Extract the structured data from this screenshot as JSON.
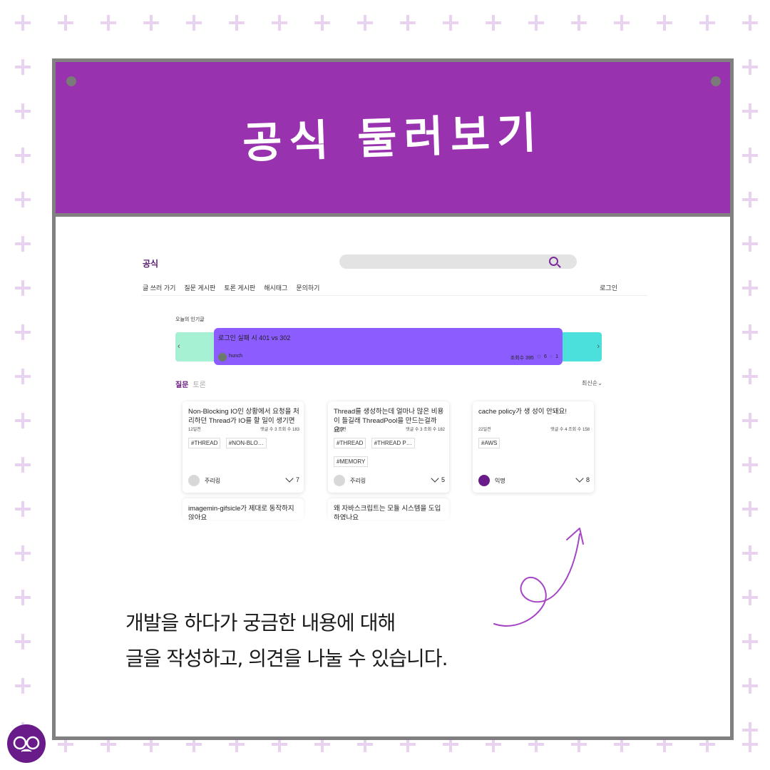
{
  "header": {
    "title": "공식 둘러보기"
  },
  "site": {
    "brand": "공식",
    "nav": [
      "글 쓰러 가기",
      "질문 게시판",
      "토론 게시판",
      "해시태그",
      "문의하기"
    ],
    "login": "로그인",
    "popular_label": "오늘의 인기글",
    "carousel": {
      "prev": "‹",
      "next": "›",
      "title": "로그인 실패 시 401 vs 302",
      "author": "hunch",
      "views": "조회수 395",
      "likes": "6",
      "comments": "1"
    },
    "tabs": {
      "question": "질문",
      "debate": "토론"
    },
    "sort": "최신순",
    "cards": [
      {
        "title": "Non-Blocking IO인 상황에서 요청을 처리하던 Thread가 IO를 할 일이 생기면",
        "date": "12일전",
        "stats": "댓글 수 3  조회 수 183",
        "tags": [
          "#THREAD",
          "#NON-BLO…"
        ],
        "author": "주리링",
        "likes": "7"
      },
      {
        "title": "Thread를 생성하는데 얼마나 많은 비용이 들길래 ThreadPool을 만드는걸까요?",
        "date": "13일전",
        "stats": "댓글 수 3  조회 수 182",
        "tags": [
          "#THREAD",
          "#THREAD P…",
          "#MEMORY"
        ],
        "author": "주리링",
        "likes": "5"
      },
      {
        "title": "cache policy가 생 성이 안돼요!",
        "date": "22일전",
        "stats": "댓글 수 4  조회 수 158",
        "tags": [
          "#AWS"
        ],
        "author": "익명",
        "likes": "8"
      },
      {
        "title": "imagemin-gifsicle가 제대로 동작하지 않아요"
      },
      {
        "title": "왜 자바스크립트는 모듈 시스템을 도입하였나요"
      }
    ]
  },
  "caption": {
    "line1": "개발을 하다가 궁금한 내용에 대해",
    "line2": "글을 작성하고, 의견을 나눌 수 있습니다."
  },
  "colors": {
    "band": "#9932ae",
    "carousel_main": "#8c5cff",
    "carousel_left": "#a6f1d3",
    "carousel_right": "#4ce0dc",
    "brand": "#6a1b8a"
  }
}
